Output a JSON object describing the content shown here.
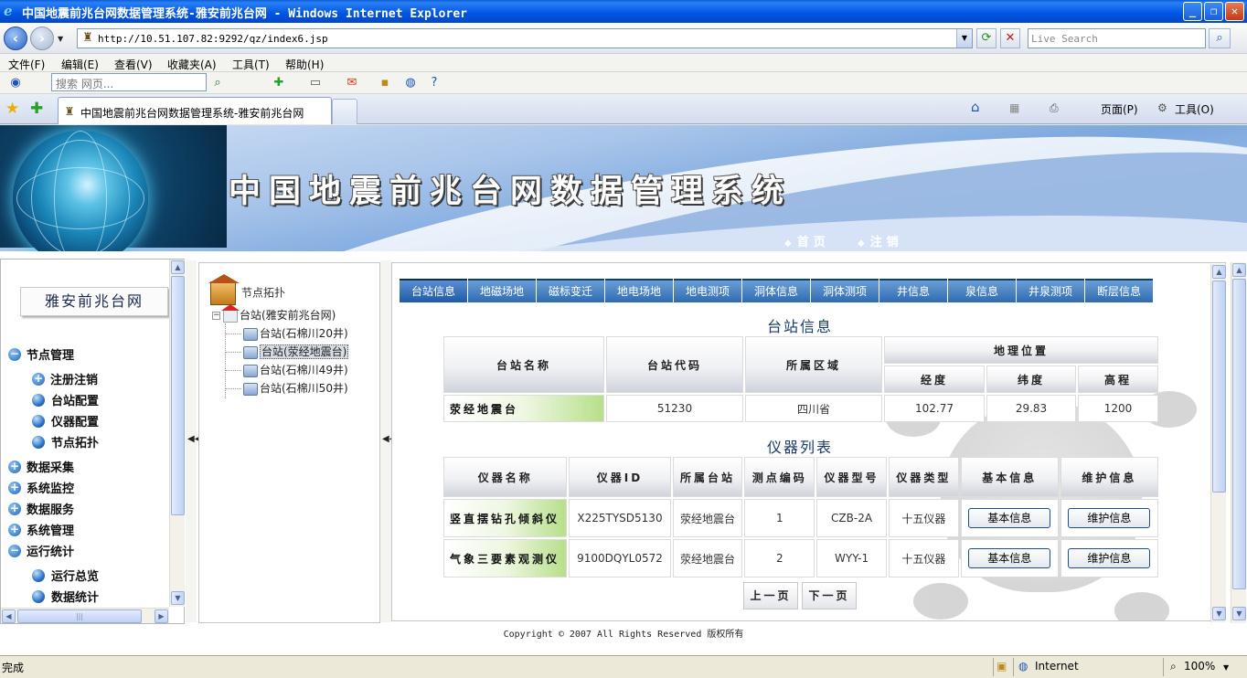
{
  "window": {
    "title": "中国地震前兆台网数据管理系统-雅安前兆台网 - Windows Internet Explorer",
    "min": "_",
    "restore": "❐",
    "close": "✕"
  },
  "addressbar": {
    "url": "http://10.51.107.82:9292/qz/index6.jsp",
    "search_placeholder": "Live Search"
  },
  "menubar": {
    "items": [
      "文件(F)",
      "编辑(E)",
      "查看(V)",
      "收藏夹(A)",
      "工具(T)",
      "帮助(H)"
    ]
  },
  "toolbar": {
    "search_placeholder": "搜索 网页..."
  },
  "browser_tab": {
    "label": "中国地震前兆台网数据管理系统-雅安前兆台网"
  },
  "commandbar": {
    "page": "页面(P)",
    "tools": "工具(O)"
  },
  "banner": {
    "title": "中国地震前兆台网数据管理系统",
    "nav_home": "首页",
    "nav_logout": "注销"
  },
  "sidebar": {
    "site_name": "雅安前兆台网",
    "groups": [
      {
        "label": "节点管理",
        "expanded": true,
        "items": [
          "注册注销",
          "台站配置",
          "仪器配置",
          "节点拓扑"
        ]
      },
      {
        "label": "数据采集",
        "expanded": false
      },
      {
        "label": "系统监控",
        "expanded": false
      },
      {
        "label": "数据服务",
        "expanded": false
      },
      {
        "label": "系统管理",
        "expanded": false
      },
      {
        "label": "运行统计",
        "expanded": true,
        "items": [
          "运行总览",
          "数据统计"
        ]
      }
    ]
  },
  "tree": {
    "root_label": "节点拓扑",
    "parent": "台站(雅安前兆台网)",
    "children": [
      "台站(石棉川20井)",
      "台站(荥经地震台)",
      "台站(石棉川49井)",
      "台站(石棉川50井)"
    ]
  },
  "content_tabs": [
    "台站信息",
    "地磁场地",
    "磁标变迁",
    "地电场地",
    "地电测项",
    "洞体信息",
    "洞体测项",
    "井信息",
    "泉信息",
    "井泉测项",
    "断层信息"
  ],
  "station_info": {
    "title": "台站信息",
    "headers": {
      "name": "台站名称",
      "code": "台站代码",
      "region": "所属区域",
      "location": "地理位置",
      "lon": "经度",
      "lat": "纬度",
      "elev": "高程"
    },
    "row": {
      "name": "荥经地震台",
      "code": "51230",
      "region": "四川省",
      "lon": "102.77",
      "lat": "29.83",
      "elev": "1200"
    }
  },
  "instrument_list": {
    "title": "仪器列表",
    "headers": [
      "仪器名称",
      "仪器ID",
      "所属台站",
      "测点编码",
      "仪器型号",
      "仪器类型",
      "基本信息",
      "维护信息"
    ],
    "rows": [
      {
        "name": "竖直摆钻孔倾斜仪",
        "id": "X225TYSD5130",
        "station": "荥经地震台",
        "point": "1",
        "model": "CZB-2A",
        "type": "十五仪器",
        "basic": "基本信息",
        "maint": "维护信息"
      },
      {
        "name": "气象三要素观测仪",
        "id": "9100DQYL0572",
        "station": "荥经地震台",
        "point": "2",
        "model": "WYY-1",
        "type": "十五仪器",
        "basic": "基本信息",
        "maint": "维护信息"
      }
    ],
    "prev": "上一页",
    "next": "下一页"
  },
  "footer": {
    "copyright": "Copyright © 2007 All Rights Reserved  版权所有"
  },
  "statusbar": {
    "status": "完成",
    "zone": "Internet",
    "zoom": "100%"
  }
}
